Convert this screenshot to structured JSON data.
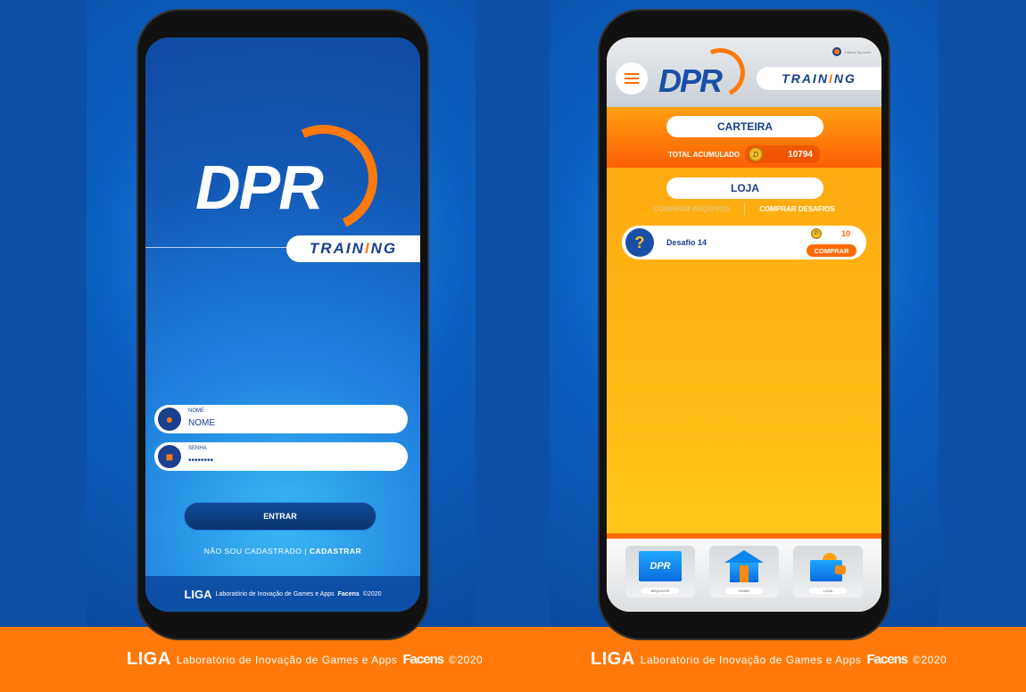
{
  "brand": {
    "logo": "DPR",
    "subtitle": "TRAINING",
    "liga": "LIGA",
    "lab_text": "Laboratório de Inovação de Games e Apps",
    "facens": "Facens",
    "copyright": "©2020"
  },
  "login": {
    "name_label": "NOME",
    "name_value": "NOME",
    "password_label": "SENHA",
    "password_value": "••••••••",
    "submit": "ENTRAR",
    "not_registered": "NÃO SOU CADASTRADO",
    "separator": "|",
    "register": "CADASTRAR"
  },
  "store": {
    "user_name": "Mateus Dyonisio",
    "wallet_title": "CARTEIRA",
    "total_label": "TOTAL ACUMULADO",
    "total_value": "10794",
    "shop_title": "LOJA",
    "tabs": [
      {
        "label": "COMPRAR ARQUIVOS",
        "active": false
      },
      {
        "label": "COMPRAR DESAFIOS",
        "active": true
      }
    ],
    "items": [
      {
        "name": "Desafio 14",
        "price": "10",
        "action": "COMPRAR"
      }
    ],
    "nav": [
      {
        "label": "ARQUIVOS",
        "icon": "folder-icon"
      },
      {
        "label": "HOME",
        "icon": "home-icon"
      },
      {
        "label": "LOJA",
        "icon": "wallet-icon"
      }
    ]
  },
  "colors": {
    "brand_blue": "#1a3f8f",
    "accent_orange": "#ff7a0a"
  }
}
